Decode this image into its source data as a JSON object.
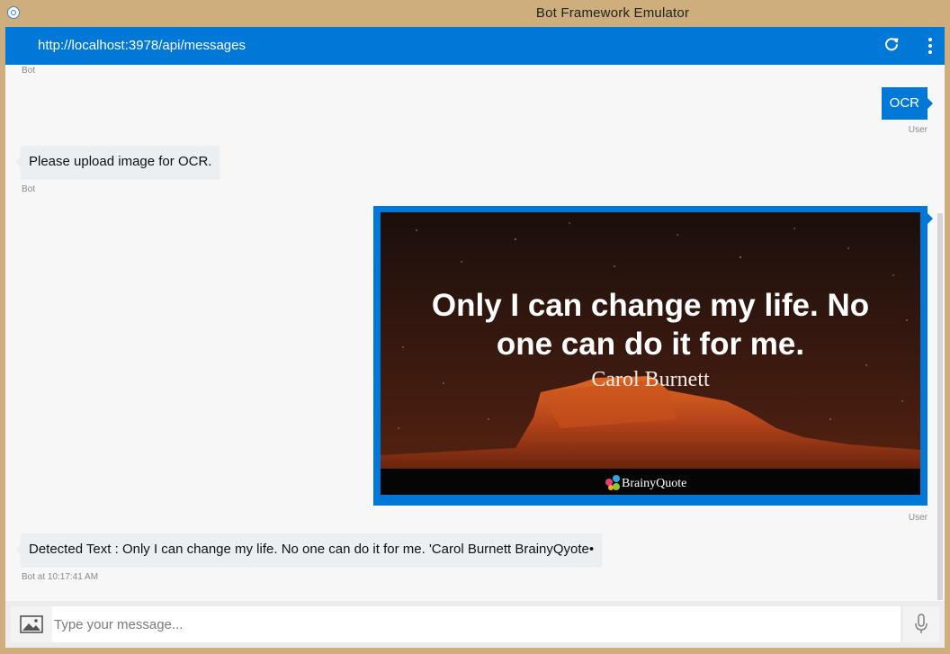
{
  "window": {
    "title": "Bot Framework Emulator",
    "url": "http://localhost:3978/api/messages"
  },
  "messages": [
    {
      "sender_label": "Bot"
    },
    {
      "text": "OCR",
      "sender_label": "User"
    },
    {
      "text": "Please upload image for OCR.",
      "sender_label": "Bot"
    },
    {
      "sender_label": "User"
    },
    {
      "text": "Detected Text : Only I can change my life. No one can do it for me. 'Carol Burnett BrainyQyote•",
      "sender_label": "Bot at 10:17:41 AM"
    }
  ],
  "attachment": {
    "quote_line1": "Only I can change my life. No",
    "quote_line2": "one can do it for me.",
    "author": "Carol Burnett",
    "watermark": "BrainyQuote"
  },
  "input": {
    "placeholder": "Type your message..."
  },
  "icons": {
    "refresh": "refresh-icon",
    "more": "more-vertical-icon",
    "attach": "image-upload-icon",
    "mic": "microphone-icon",
    "app": "app-logo-icon"
  },
  "colors": {
    "accent": "#0078d7",
    "frame": "#cfae7d",
    "bot_bubble": "#eceff1",
    "chat_background": "#f7f7f7"
  }
}
